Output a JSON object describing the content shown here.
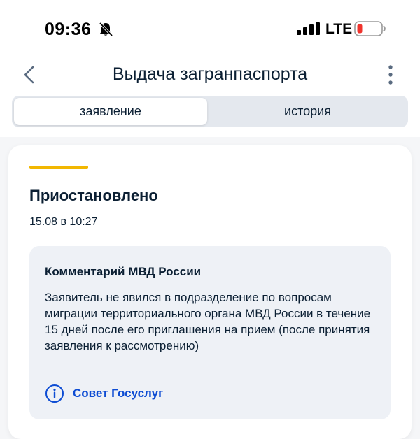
{
  "status_bar": {
    "time": "09:36",
    "network": "LTE",
    "icons": [
      "bell-muted-icon",
      "signal-icon",
      "battery-low-icon"
    ],
    "battery_color": "#f0332c"
  },
  "header": {
    "title": "Выдача загранпаспорта",
    "back_icon": "chevron-left-icon",
    "menu_icon": "more-vertical-icon"
  },
  "tabs": [
    {
      "label": "заявление",
      "active": true
    },
    {
      "label": "история",
      "active": false
    }
  ],
  "status_card": {
    "accent_color": "#f2b701",
    "title": "Приостановлено",
    "date": "15.08 в 10:27",
    "comment": {
      "heading": "Комментарий МВД России",
      "text": "Заявитель не явился в подразделение по вопросам миграции территориального органа МВД России в течение 15 дней после его приглашения на прием (после принятия заявления к рассмотрению)"
    },
    "advice": {
      "label": "Совет Госуслуг",
      "icon": "info-circle-icon",
      "color": "#0d4cd3"
    }
  }
}
